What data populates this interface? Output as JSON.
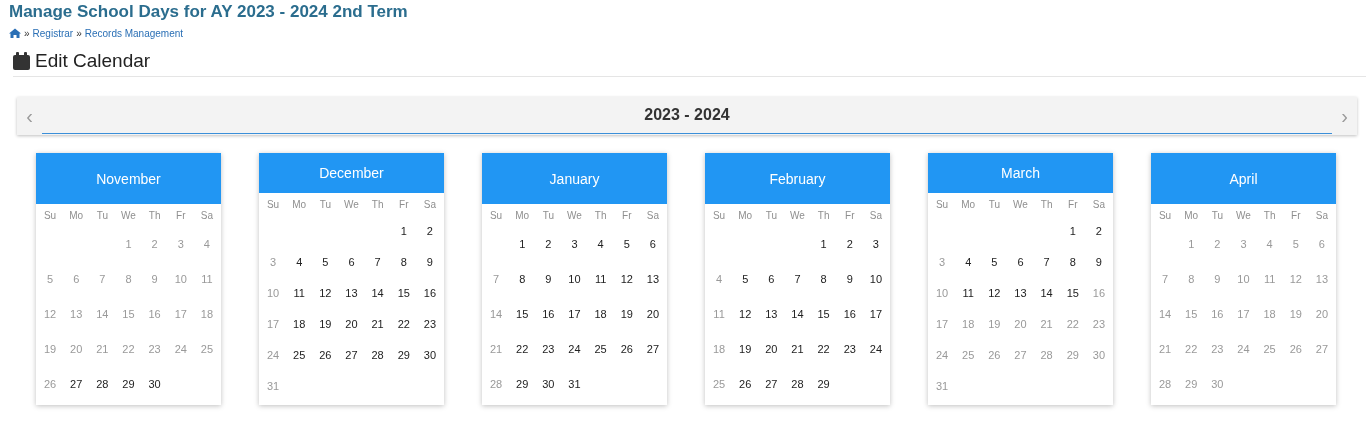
{
  "page_title": "Manage School Days for AY 2023 - 2024 2nd Term",
  "breadcrumb": [
    "Registrar",
    "Records Management"
  ],
  "breadcrumb_separators": [
    "»",
    "»"
  ],
  "section_title": "Edit Calendar",
  "year_bar": {
    "label": "2023 - 2024",
    "prev": "‹",
    "next": "›"
  },
  "months": [
    {
      "name": "November",
      "weekdays": [
        "Su",
        "Mo",
        "Tu",
        "We",
        "Th",
        "Fr",
        "Sa"
      ],
      "weeks": [
        [
          {
            "day": "1",
            "disabled": true
          },
          {
            "day": "2",
            "disabled": true
          },
          {
            "day": "3",
            "disabled": true
          },
          {
            "day": "4",
            "disabled": true
          }
        ],
        [
          {
            "day": "5",
            "disabled": true
          },
          {
            "day": "6",
            "disabled": true
          },
          {
            "day": "7",
            "disabled": true
          },
          {
            "day": "8",
            "disabled": true
          },
          {
            "day": "9",
            "disabled": true
          },
          {
            "day": "10",
            "disabled": true
          },
          {
            "day": "11",
            "disabled": true
          }
        ],
        [
          {
            "day": "12",
            "disabled": true
          },
          {
            "day": "13",
            "disabled": true
          },
          {
            "day": "14",
            "disabled": true
          },
          {
            "day": "15",
            "disabled": true
          },
          {
            "day": "16",
            "disabled": true
          },
          {
            "day": "17",
            "disabled": true
          },
          {
            "day": "18",
            "disabled": true
          }
        ],
        [
          {
            "day": "19",
            "disabled": true
          },
          {
            "day": "20",
            "disabled": true
          },
          {
            "day": "21",
            "disabled": true
          },
          {
            "day": "22",
            "disabled": true
          },
          {
            "day": "23",
            "disabled": true
          },
          {
            "day": "24",
            "disabled": true
          },
          {
            "day": "25",
            "disabled": true
          }
        ],
        [
          {
            "day": "26",
            "disabled": true
          },
          {
            "day": "27",
            "disabled": false
          },
          {
            "day": "28",
            "disabled": false
          },
          {
            "day": "29",
            "disabled": false
          },
          {
            "day": "30",
            "disabled": false
          }
        ]
      ]
    },
    {
      "name": "December",
      "weekdays": [
        "Su",
        "Mo",
        "Tu",
        "We",
        "Th",
        "Fr",
        "Sa"
      ],
      "weeks": [
        [
          {
            "day": "1",
            "disabled": false
          },
          {
            "day": "2",
            "disabled": false
          }
        ],
        [
          {
            "day": "3",
            "disabled": true
          },
          {
            "day": "4",
            "disabled": false
          },
          {
            "day": "5",
            "disabled": false
          },
          {
            "day": "6",
            "disabled": false
          },
          {
            "day": "7",
            "disabled": false
          },
          {
            "day": "8",
            "disabled": false
          },
          {
            "day": "9",
            "disabled": false
          }
        ],
        [
          {
            "day": "10",
            "disabled": true
          },
          {
            "day": "11",
            "disabled": false
          },
          {
            "day": "12",
            "disabled": false
          },
          {
            "day": "13",
            "disabled": false
          },
          {
            "day": "14",
            "disabled": false
          },
          {
            "day": "15",
            "disabled": false
          },
          {
            "day": "16",
            "disabled": false
          }
        ],
        [
          {
            "day": "17",
            "disabled": true
          },
          {
            "day": "18",
            "disabled": false
          },
          {
            "day": "19",
            "disabled": false
          },
          {
            "day": "20",
            "disabled": false
          },
          {
            "day": "21",
            "disabled": false
          },
          {
            "day": "22",
            "disabled": false
          },
          {
            "day": "23",
            "disabled": false
          }
        ],
        [
          {
            "day": "24",
            "disabled": true
          },
          {
            "day": "25",
            "disabled": false
          },
          {
            "day": "26",
            "disabled": false
          },
          {
            "day": "27",
            "disabled": false
          },
          {
            "day": "28",
            "disabled": false
          },
          {
            "day": "29",
            "disabled": false
          },
          {
            "day": "30",
            "disabled": false
          }
        ],
        [
          {
            "day": "31",
            "disabled": true
          }
        ]
      ]
    },
    {
      "name": "January",
      "weekdays": [
        "Su",
        "Mo",
        "Tu",
        "We",
        "Th",
        "Fr",
        "Sa"
      ],
      "weeks": [
        [
          {
            "day": "1",
            "disabled": false
          },
          {
            "day": "2",
            "disabled": false
          },
          {
            "day": "3",
            "disabled": false
          },
          {
            "day": "4",
            "disabled": false
          },
          {
            "day": "5",
            "disabled": false
          },
          {
            "day": "6",
            "disabled": false
          }
        ],
        [
          {
            "day": "7",
            "disabled": true
          },
          {
            "day": "8",
            "disabled": false
          },
          {
            "day": "9",
            "disabled": false
          },
          {
            "day": "10",
            "disabled": false
          },
          {
            "day": "11",
            "disabled": false
          },
          {
            "day": "12",
            "disabled": false
          },
          {
            "day": "13",
            "disabled": false
          }
        ],
        [
          {
            "day": "14",
            "disabled": true
          },
          {
            "day": "15",
            "disabled": false
          },
          {
            "day": "16",
            "disabled": false
          },
          {
            "day": "17",
            "disabled": false
          },
          {
            "day": "18",
            "disabled": false
          },
          {
            "day": "19",
            "disabled": false
          },
          {
            "day": "20",
            "disabled": false
          }
        ],
        [
          {
            "day": "21",
            "disabled": true
          },
          {
            "day": "22",
            "disabled": false
          },
          {
            "day": "23",
            "disabled": false
          },
          {
            "day": "24",
            "disabled": false
          },
          {
            "day": "25",
            "disabled": false
          },
          {
            "day": "26",
            "disabled": false
          },
          {
            "day": "27",
            "disabled": false
          }
        ],
        [
          {
            "day": "28",
            "disabled": true
          },
          {
            "day": "29",
            "disabled": false
          },
          {
            "day": "30",
            "disabled": false
          },
          {
            "day": "31",
            "disabled": false
          }
        ]
      ]
    },
    {
      "name": "February",
      "weekdays": [
        "Su",
        "Mo",
        "Tu",
        "We",
        "Th",
        "Fr",
        "Sa"
      ],
      "weeks": [
        [
          {
            "day": "1",
            "disabled": false
          },
          {
            "day": "2",
            "disabled": false
          },
          {
            "day": "3",
            "disabled": false
          }
        ],
        [
          {
            "day": "4",
            "disabled": true
          },
          {
            "day": "5",
            "disabled": false
          },
          {
            "day": "6",
            "disabled": false
          },
          {
            "day": "7",
            "disabled": false
          },
          {
            "day": "8",
            "disabled": false
          },
          {
            "day": "9",
            "disabled": false
          },
          {
            "day": "10",
            "disabled": false
          }
        ],
        [
          {
            "day": "11",
            "disabled": true
          },
          {
            "day": "12",
            "disabled": false
          },
          {
            "day": "13",
            "disabled": false
          },
          {
            "day": "14",
            "disabled": false
          },
          {
            "day": "15",
            "disabled": false
          },
          {
            "day": "16",
            "disabled": false
          },
          {
            "day": "17",
            "disabled": false
          }
        ],
        [
          {
            "day": "18",
            "disabled": true
          },
          {
            "day": "19",
            "disabled": false
          },
          {
            "day": "20",
            "disabled": false
          },
          {
            "day": "21",
            "disabled": false
          },
          {
            "day": "22",
            "disabled": false
          },
          {
            "day": "23",
            "disabled": false
          },
          {
            "day": "24",
            "disabled": false
          }
        ],
        [
          {
            "day": "25",
            "disabled": true
          },
          {
            "day": "26",
            "disabled": false
          },
          {
            "day": "27",
            "disabled": false
          },
          {
            "day": "28",
            "disabled": false
          },
          {
            "day": "29",
            "disabled": false
          }
        ]
      ]
    },
    {
      "name": "March",
      "weekdays": [
        "Su",
        "Mo",
        "Tu",
        "We",
        "Th",
        "Fr",
        "Sa"
      ],
      "weeks": [
        [
          {
            "day": "1",
            "disabled": false
          },
          {
            "day": "2",
            "disabled": false
          }
        ],
        [
          {
            "day": "3",
            "disabled": true
          },
          {
            "day": "4",
            "disabled": false
          },
          {
            "day": "5",
            "disabled": false
          },
          {
            "day": "6",
            "disabled": false
          },
          {
            "day": "7",
            "disabled": false
          },
          {
            "day": "8",
            "disabled": false
          },
          {
            "day": "9",
            "disabled": false
          }
        ],
        [
          {
            "day": "10",
            "disabled": true
          },
          {
            "day": "11",
            "disabled": false
          },
          {
            "day": "12",
            "disabled": false
          },
          {
            "day": "13",
            "disabled": false
          },
          {
            "day": "14",
            "disabled": false
          },
          {
            "day": "15",
            "disabled": false
          },
          {
            "day": "16",
            "disabled": true
          }
        ],
        [
          {
            "day": "17",
            "disabled": true
          },
          {
            "day": "18",
            "disabled": true
          },
          {
            "day": "19",
            "disabled": true
          },
          {
            "day": "20",
            "disabled": true
          },
          {
            "day": "21",
            "disabled": true
          },
          {
            "day": "22",
            "disabled": true
          },
          {
            "day": "23",
            "disabled": true
          }
        ],
        [
          {
            "day": "24",
            "disabled": true
          },
          {
            "day": "25",
            "disabled": true
          },
          {
            "day": "26",
            "disabled": true
          },
          {
            "day": "27",
            "disabled": true
          },
          {
            "day": "28",
            "disabled": true
          },
          {
            "day": "29",
            "disabled": true
          },
          {
            "day": "30",
            "disabled": true
          }
        ],
        [
          {
            "day": "31",
            "disabled": true
          }
        ]
      ]
    },
    {
      "name": "April",
      "weekdays": [
        "Su",
        "Mo",
        "Tu",
        "We",
        "Th",
        "Fr",
        "Sa"
      ],
      "weeks": [
        [
          {
            "day": "1",
            "disabled": true
          },
          {
            "day": "2",
            "disabled": true
          },
          {
            "day": "3",
            "disabled": true
          },
          {
            "day": "4",
            "disabled": true
          },
          {
            "day": "5",
            "disabled": true
          },
          {
            "day": "6",
            "disabled": true
          }
        ],
        [
          {
            "day": "7",
            "disabled": true
          },
          {
            "day": "8",
            "disabled": true
          },
          {
            "day": "9",
            "disabled": true
          },
          {
            "day": "10",
            "disabled": true
          },
          {
            "day": "11",
            "disabled": true
          },
          {
            "day": "12",
            "disabled": true
          },
          {
            "day": "13",
            "disabled": true
          }
        ],
        [
          {
            "day": "14",
            "disabled": true
          },
          {
            "day": "15",
            "disabled": true
          },
          {
            "day": "16",
            "disabled": true
          },
          {
            "day": "17",
            "disabled": true
          },
          {
            "day": "18",
            "disabled": true
          },
          {
            "day": "19",
            "disabled": true
          },
          {
            "day": "20",
            "disabled": true
          }
        ],
        [
          {
            "day": "21",
            "disabled": true
          },
          {
            "day": "22",
            "disabled": true
          },
          {
            "day": "23",
            "disabled": true
          },
          {
            "day": "24",
            "disabled": true
          },
          {
            "day": "25",
            "disabled": true
          },
          {
            "day": "26",
            "disabled": true
          },
          {
            "day": "27",
            "disabled": true
          }
        ],
        [
          {
            "day": "28",
            "disabled": true
          },
          {
            "day": "29",
            "disabled": true
          },
          {
            "day": "30",
            "disabled": true
          }
        ]
      ]
    }
  ]
}
